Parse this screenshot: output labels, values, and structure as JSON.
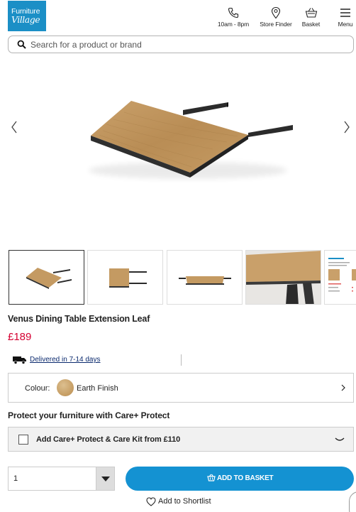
{
  "header": {
    "logo_line1": "Furniture",
    "logo_line2": "Village",
    "nav": [
      {
        "label": "10am - 8pm",
        "icon": "phone-icon"
      },
      {
        "label": "Store Finder",
        "icon": "location-pin-icon"
      },
      {
        "label": "Basket",
        "icon": "basket-icon"
      },
      {
        "label": "Menu",
        "icon": "hamburger-menu-icon"
      }
    ]
  },
  "search": {
    "placeholder": "Search for a product or brand",
    "icon": "search-icon"
  },
  "gallery": {
    "prev_icon": "chevron-left-icon",
    "next_icon": "chevron-right-icon",
    "thumbnails": [
      "thumb-leaf-angled",
      "thumb-leaf-top",
      "thumb-leaf-side",
      "thumb-table-closeup",
      "thumb-spec-sheet"
    ]
  },
  "product": {
    "title": "Venus Dining Table Extension Leaf",
    "price": "£189",
    "delivery": "Delivered in 7-14 days"
  },
  "colour": {
    "label": "Colour:",
    "value": "Earth Finish",
    "swatch_color": "#c9a06a"
  },
  "protect": {
    "heading": "Protect your furniture with Care+ Protect",
    "option": "Add Care+ Protect & Care Kit from £110"
  },
  "purchase": {
    "quantity": "1",
    "add_to_basket": "ADD TO BASKET",
    "shortlist": "Add to Shortlist"
  },
  "colors": {
    "brand_blue": "#1b8fc6",
    "button_blue": "#1492d2",
    "price_red": "#d50032"
  }
}
